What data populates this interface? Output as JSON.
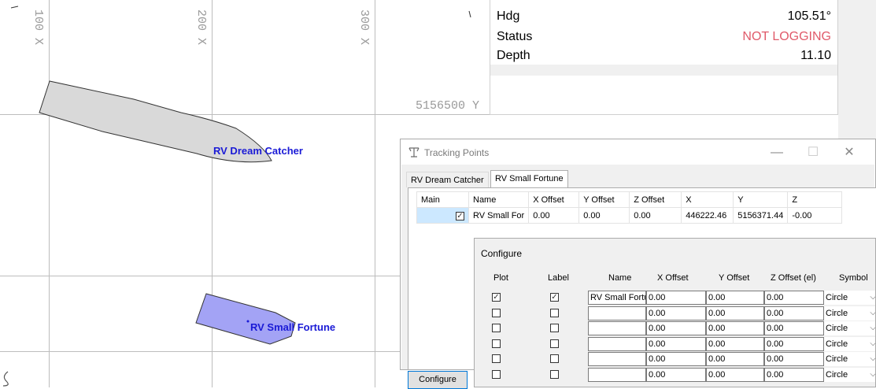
{
  "map": {
    "x_labels": [
      "100 X",
      "200 X",
      "300 X"
    ],
    "y_label": "5156500 Y",
    "vessels": [
      {
        "name": "RV Dream Catcher",
        "fill": "#d9d9d9"
      },
      {
        "name": "RV Small Fortune",
        "fill": "#a3a3f5"
      }
    ]
  },
  "info": {
    "rows": [
      {
        "label": "Hdg",
        "value": "105.51°"
      },
      {
        "label": "Status",
        "value": "NOT LOGGING"
      },
      {
        "label": "Depth",
        "value": "11.10"
      }
    ],
    "status_color": "#e05a6a"
  },
  "tracking_window": {
    "title": "Tracking Points",
    "minimize_glyph": "—",
    "maximize_glyph": "☐",
    "close_glyph": "✕",
    "tabs": [
      "RV Dream Catcher",
      "RV Small Fortune"
    ],
    "active_tab": "RV Small Fortune",
    "columns": [
      "Main",
      "Name",
      "X Offset",
      "Y Offset",
      "Z Offset",
      "X",
      "Y",
      "Z"
    ],
    "rows": [
      {
        "main_checked": true,
        "name": "RV Small For",
        "x_offset": "0.00",
        "y_offset": "0.00",
        "z_offset": "0.00",
        "x": "446222.46",
        "y": "5156371.44",
        "z": "-0.00"
      }
    ],
    "configure_button": "Configure"
  },
  "configure_dialog": {
    "title": "Configure",
    "columns": [
      "Plot",
      "Label",
      "Name",
      "X Offset",
      "Y Offset",
      "Z Offset (el)",
      "Symbol"
    ],
    "rows": [
      {
        "plot": true,
        "label": true,
        "name": "RV Small Fortu",
        "x_offset": "0.00",
        "y_offset": "0.00",
        "z_offset": "0.00",
        "symbol": "Circle"
      },
      {
        "plot": false,
        "label": false,
        "name": "",
        "x_offset": "0.00",
        "y_offset": "0.00",
        "z_offset": "0.00",
        "symbol": "Circle"
      },
      {
        "plot": false,
        "label": false,
        "name": "",
        "x_offset": "0.00",
        "y_offset": "0.00",
        "z_offset": "0.00",
        "symbol": "Circle"
      },
      {
        "plot": false,
        "label": false,
        "name": "",
        "x_offset": "0.00",
        "y_offset": "0.00",
        "z_offset": "0.00",
        "symbol": "Circle"
      },
      {
        "plot": false,
        "label": false,
        "name": "",
        "x_offset": "0.00",
        "y_offset": "0.00",
        "z_offset": "0.00",
        "symbol": "Circle"
      },
      {
        "plot": false,
        "label": false,
        "name": "",
        "x_offset": "0.00",
        "y_offset": "0.00",
        "z_offset": "0.00",
        "symbol": "Circle"
      }
    ]
  }
}
